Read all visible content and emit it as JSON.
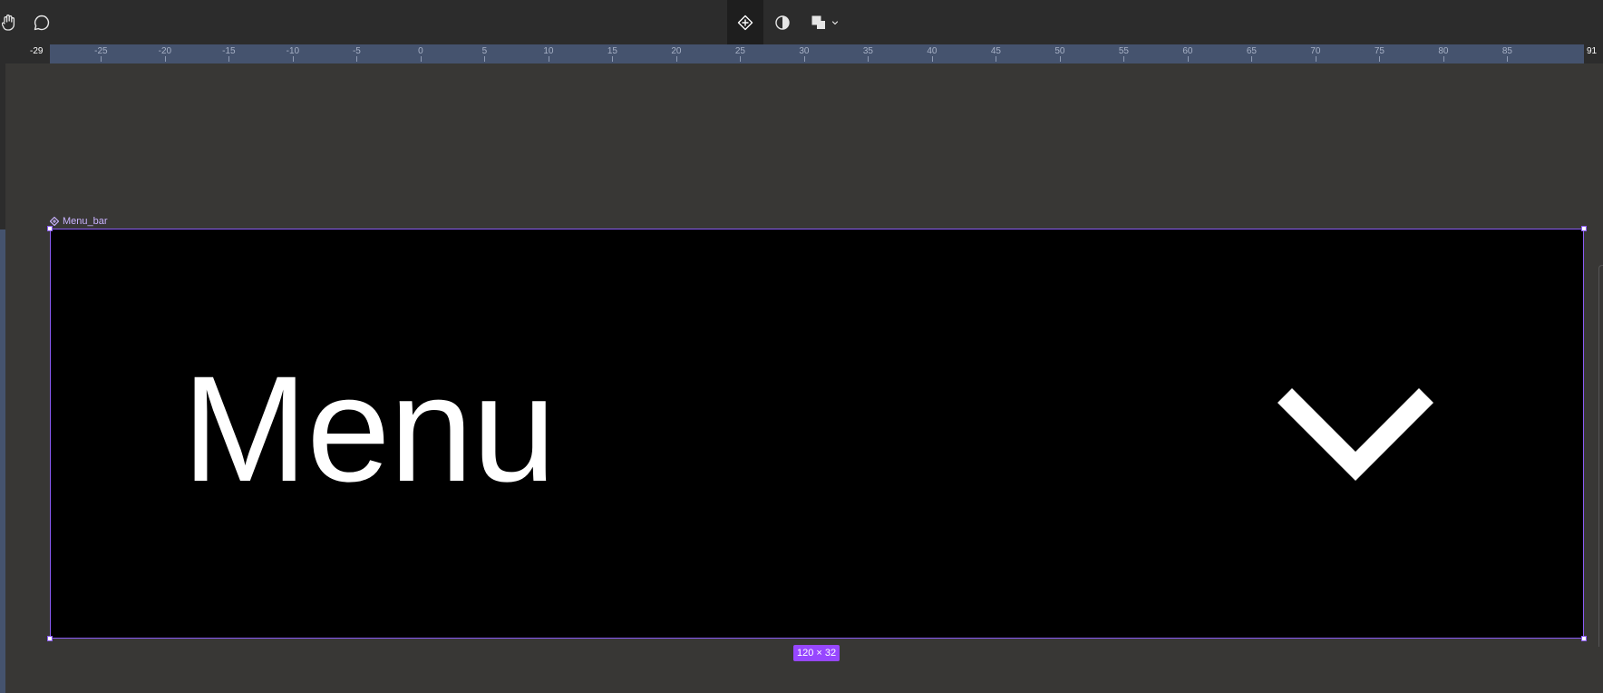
{
  "toolbar": {
    "left_icons": [
      "hand-icon",
      "comment-icon"
    ],
    "center_icons": [
      "component-icon",
      "contrast-icon",
      "boolean-union-icon",
      "chevron-down-icon"
    ]
  },
  "ruler": {
    "start_label": "-29",
    "end_label": "91",
    "ticks": [
      "-25",
      "-20",
      "-15",
      "-10",
      "-5",
      "0",
      "5",
      "10",
      "15",
      "20",
      "25",
      "30",
      "35",
      "40",
      "45",
      "50",
      "55",
      "60",
      "65",
      "70",
      "75",
      "80",
      "85"
    ]
  },
  "frame": {
    "name": "Menu_bar",
    "text": "Menu",
    "size_badge": "120 × 32",
    "icon": "chevron-down-icon",
    "background": "#000000",
    "selection_color": "#8b5cf6"
  },
  "colors": {
    "canvas": "#383735",
    "toolbar": "#2c2c2c",
    "ruler_band": "#45536e",
    "badge": "#9747ff"
  }
}
